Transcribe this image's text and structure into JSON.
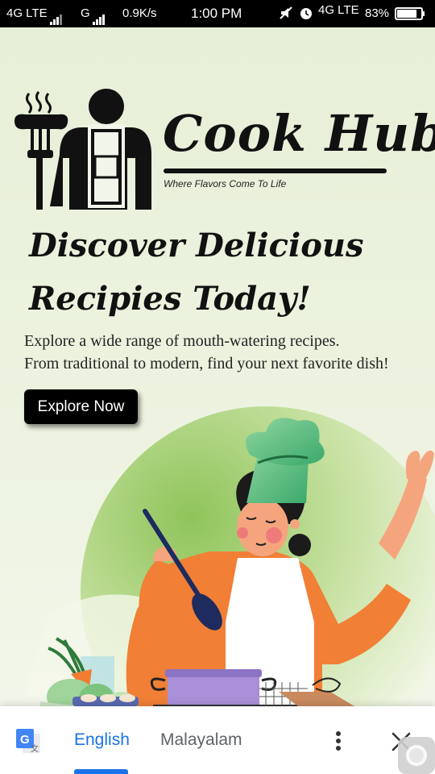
{
  "status_bar": {
    "network_left": "4G LTE",
    "network_mid": "G",
    "speed": "0.9K/s",
    "time": "1:00 PM",
    "network_right": "4G LTE",
    "battery": "83%",
    "battery_level": 0.83
  },
  "logo": {
    "name": "Cook Hub",
    "tagline": "Where Flavors Come To Life"
  },
  "hero": {
    "headline_line1": "Discover Delicious",
    "headline_line2": "Recipies Today!",
    "subtext_line1": "Explore a wide range of mouth-watering recipes.",
    "subtext_line2": "From traditional to modern, find your next favorite dish!",
    "cta_label": "Explore Now"
  },
  "translate_bar": {
    "languages": [
      "English",
      "Malayalam"
    ],
    "selected": "English",
    "accent_color": "#1a73e8"
  },
  "colors": {
    "page_background": "#eaf1da",
    "button_background": "#000000",
    "headline": "#111111"
  }
}
